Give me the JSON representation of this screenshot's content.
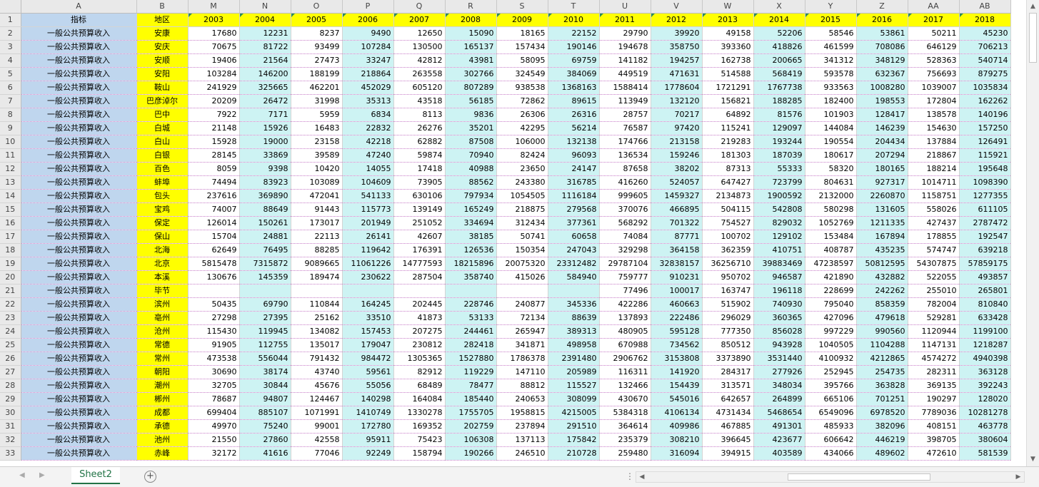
{
  "columns": [
    "A",
    "B",
    "M",
    "N",
    "O",
    "P",
    "Q",
    "R",
    "S",
    "T",
    "U",
    "V",
    "W",
    "X",
    "Y",
    "Z",
    "AA",
    "AB"
  ],
  "header": {
    "indicator": "指标",
    "region": "地区",
    "years": [
      "2003",
      "2004",
      "2005",
      "2006",
      "2007",
      "2008",
      "2009",
      "2010",
      "2011",
      "2012",
      "2013",
      "2014",
      "2015",
      "2016",
      "2017",
      "2018"
    ]
  },
  "rows": [
    {
      "num": "2",
      "indicator": "一般公共预算收入",
      "region": "安康",
      "values": [
        "17680",
        "12231",
        "8237",
        "9490",
        "12650",
        "15090",
        "18165",
        "22152",
        "29790",
        "39920",
        "49158",
        "52206",
        "58546",
        "53861",
        "50211",
        "45230"
      ]
    },
    {
      "num": "3",
      "indicator": "一般公共预算收入",
      "region": "安庆",
      "values": [
        "70675",
        "81722",
        "93499",
        "107284",
        "130500",
        "165137",
        "157434",
        "190146",
        "194678",
        "358750",
        "393360",
        "418826",
        "461599",
        "708086",
        "646129",
        "706213"
      ]
    },
    {
      "num": "4",
      "indicator": "一般公共预算收入",
      "region": "安顺",
      "values": [
        "19406",
        "21564",
        "27473",
        "33247",
        "42812",
        "43981",
        "58095",
        "69759",
        "141182",
        "194257",
        "162738",
        "200665",
        "341312",
        "348129",
        "528363",
        "540714"
      ]
    },
    {
      "num": "5",
      "indicator": "一般公共预算收入",
      "region": "安阳",
      "values": [
        "103284",
        "146200",
        "188199",
        "218864",
        "263558",
        "302766",
        "324549",
        "384069",
        "449519",
        "471631",
        "514588",
        "568419",
        "593578",
        "632367",
        "756693",
        "879275"
      ]
    },
    {
      "num": "6",
      "indicator": "一般公共预算收入",
      "region": "鞍山",
      "values": [
        "241929",
        "325665",
        "462201",
        "452029",
        "605120",
        "807289",
        "938538",
        "1368163",
        "1588414",
        "1778604",
        "1721291",
        "1767738",
        "933563",
        "1008280",
        "1039007",
        "1035834"
      ]
    },
    {
      "num": "7",
      "indicator": "一般公共预算收入",
      "region": "巴彦淖尔",
      "values": [
        "20209",
        "26472",
        "31998",
        "35313",
        "43518",
        "56185",
        "72862",
        "89615",
        "113949",
        "132120",
        "156821",
        "188285",
        "182400",
        "198553",
        "172804",
        "162262"
      ]
    },
    {
      "num": "8",
      "indicator": "一般公共预算收入",
      "region": "巴中",
      "values": [
        "7922",
        "7171",
        "5959",
        "6834",
        "8113",
        "9836",
        "26306",
        "26316",
        "28757",
        "70217",
        "64892",
        "81576",
        "101903",
        "128417",
        "138578",
        "140196"
      ]
    },
    {
      "num": "9",
      "indicator": "一般公共预算收入",
      "region": "白城",
      "values": [
        "21148",
        "15926",
        "16483",
        "22832",
        "26276",
        "35201",
        "42295",
        "56214",
        "76587",
        "97420",
        "115241",
        "129097",
        "144084",
        "146239",
        "154630",
        "157250"
      ]
    },
    {
      "num": "10",
      "indicator": "一般公共预算收入",
      "region": "白山",
      "values": [
        "15928",
        "19000",
        "23158",
        "42218",
        "62882",
        "87508",
        "106000",
        "132138",
        "174766",
        "213158",
        "219283",
        "193244",
        "190554",
        "204434",
        "137884",
        "126491"
      ]
    },
    {
      "num": "11",
      "indicator": "一般公共预算收入",
      "region": "白银",
      "values": [
        "28145",
        "33869",
        "39589",
        "47240",
        "59874",
        "70940",
        "82424",
        "96093",
        "136534",
        "159246",
        "181303",
        "187039",
        "180617",
        "207294",
        "218867",
        "115921"
      ]
    },
    {
      "num": "12",
      "indicator": "一般公共预算收入",
      "region": "百色",
      "values": [
        "8059",
        "9398",
        "10420",
        "14055",
        "17418",
        "40988",
        "23650",
        "24147",
        "87658",
        "38202",
        "87313",
        "55333",
        "58320",
        "180165",
        "188214",
        "195648"
      ]
    },
    {
      "num": "13",
      "indicator": "一般公共预算收入",
      "region": "蚌埠",
      "values": [
        "74494",
        "83923",
        "103089",
        "104609",
        "73905",
        "88562",
        "243380",
        "316785",
        "416260",
        "524057",
        "647427",
        "723799",
        "804631",
        "927317",
        "1014711",
        "1098390"
      ]
    },
    {
      "num": "14",
      "indicator": "一般公共预算收入",
      "region": "包头",
      "values": [
        "237616",
        "369890",
        "472041",
        "541133",
        "630106",
        "797934",
        "1054505",
        "1116184",
        "999605",
        "1459327",
        "2134873",
        "1900592",
        "2132000",
        "2260870",
        "1158751",
        "1277355"
      ]
    },
    {
      "num": "15",
      "indicator": "一般公共预算收入",
      "region": "宝鸡",
      "values": [
        "74007",
        "88649",
        "91443",
        "115773",
        "139149",
        "165249",
        "218875",
        "279568",
        "370076",
        "466895",
        "504115",
        "542808",
        "580298",
        "131605",
        "558026",
        "611105"
      ]
    },
    {
      "num": "16",
      "indicator": "一般公共预算收入",
      "region": "保定",
      "values": [
        "126014",
        "150261",
        "173017",
        "201949",
        "251052",
        "334694",
        "312434",
        "377361",
        "568292",
        "701322",
        "754527",
        "829032",
        "1052769",
        "1211335",
        "427437",
        "2787472"
      ]
    },
    {
      "num": "17",
      "indicator": "一般公共预算收入",
      "region": "保山",
      "values": [
        "15704",
        "24881",
        "22113",
        "26141",
        "42607",
        "38185",
        "50741",
        "60658",
        "74084",
        "87771",
        "100702",
        "129102",
        "153484",
        "167894",
        "178855",
        "192547"
      ]
    },
    {
      "num": "18",
      "indicator": "一般公共预算收入",
      "region": "北海",
      "values": [
        "62649",
        "76495",
        "88285",
        "119642",
        "176391",
        "126536",
        "150354",
        "247043",
        "329298",
        "364158",
        "362359",
        "410751",
        "408787",
        "435235",
        "574747",
        "639218"
      ]
    },
    {
      "num": "19",
      "indicator": "一般公共预算收入",
      "region": "北京",
      "values": [
        "5815478",
        "7315872",
        "9089665",
        "11061226",
        "14777593",
        "18215896",
        "20075320",
        "23312482",
        "29787104",
        "32838157",
        "36256710",
        "39883469",
        "47238597",
        "50812595",
        "54307875",
        "57859175"
      ]
    },
    {
      "num": "20",
      "indicator": "一般公共预算收入",
      "region": "本溪",
      "values": [
        "130676",
        "145359",
        "189474",
        "230622",
        "287504",
        "358740",
        "415026",
        "584940",
        "759777",
        "910231",
        "950702",
        "946587",
        "421890",
        "432882",
        "522055",
        "493857"
      ]
    },
    {
      "num": "21",
      "indicator": "一般公共预算收入",
      "region": "毕节",
      "values": [
        "",
        "",
        "",
        "",
        "",
        "",
        "",
        "",
        "77496",
        "100017",
        "163747",
        "196118",
        "228699",
        "242262",
        "255010",
        "265801"
      ]
    },
    {
      "num": "22",
      "indicator": "一般公共预算收入",
      "region": "滨州",
      "values": [
        "50435",
        "69790",
        "110844",
        "164245",
        "202445",
        "228746",
        "240877",
        "345336",
        "422286",
        "460663",
        "515902",
        "740930",
        "795040",
        "858359",
        "782004",
        "810840"
      ]
    },
    {
      "num": "23",
      "indicator": "一般公共预算收入",
      "region": "亳州",
      "values": [
        "27298",
        "27395",
        "25162",
        "33510",
        "41873",
        "53133",
        "72134",
        "88639",
        "137893",
        "222486",
        "296029",
        "360365",
        "427096",
        "479618",
        "529281",
        "633428"
      ]
    },
    {
      "num": "24",
      "indicator": "一般公共预算收入",
      "region": "沧州",
      "values": [
        "115430",
        "119945",
        "134082",
        "157453",
        "207275",
        "244461",
        "265947",
        "389313",
        "480905",
        "595128",
        "777350",
        "856028",
        "997229",
        "990560",
        "1120944",
        "1199100"
      ]
    },
    {
      "num": "25",
      "indicator": "一般公共预算收入",
      "region": "常德",
      "values": [
        "91905",
        "112755",
        "135017",
        "179047",
        "230812",
        "282418",
        "341871",
        "498958",
        "670988",
        "734562",
        "850512",
        "943928",
        "1040505",
        "1104288",
        "1147131",
        "1218287"
      ]
    },
    {
      "num": "26",
      "indicator": "一般公共预算收入",
      "region": "常州",
      "values": [
        "473538",
        "556044",
        "791432",
        "984472",
        "1305365",
        "1527880",
        "1786378",
        "2391480",
        "2906762",
        "3153808",
        "3373890",
        "3531440",
        "4100932",
        "4212865",
        "4574272",
        "4940398"
      ]
    },
    {
      "num": "27",
      "indicator": "一般公共预算收入",
      "region": "朝阳",
      "values": [
        "30690",
        "38174",
        "43740",
        "59561",
        "82912",
        "119229",
        "147110",
        "205989",
        "116311",
        "141920",
        "284317",
        "277926",
        "252945",
        "254735",
        "282311",
        "363128"
      ]
    },
    {
      "num": "28",
      "indicator": "一般公共预算收入",
      "region": "潮州",
      "values": [
        "32705",
        "30844",
        "45676",
        "55056",
        "68489",
        "78477",
        "88812",
        "115527",
        "132466",
        "154439",
        "313571",
        "348034",
        "395766",
        "363828",
        "369135",
        "392243"
      ]
    },
    {
      "num": "29",
      "indicator": "一般公共预算收入",
      "region": "郴州",
      "values": [
        "78687",
        "94807",
        "124467",
        "140298",
        "164084",
        "185440",
        "240653",
        "308099",
        "430670",
        "545016",
        "642657",
        "264899",
        "665106",
        "701251",
        "190297",
        "128020"
      ]
    },
    {
      "num": "30",
      "indicator": "一般公共预算收入",
      "region": "成都",
      "values": [
        "699404",
        "885107",
        "1071991",
        "1410749",
        "1330278",
        "1755705",
        "1958815",
        "4215005",
        "5384318",
        "4106134",
        "4731434",
        "5468654",
        "6549096",
        "6978520",
        "7789036",
        "10281278"
      ]
    },
    {
      "num": "31",
      "indicator": "一般公共预算收入",
      "region": "承德",
      "values": [
        "49970",
        "75240",
        "99001",
        "172780",
        "169352",
        "202759",
        "237894",
        "291510",
        "364614",
        "409986",
        "467885",
        "491301",
        "485933",
        "382096",
        "408151",
        "463778"
      ]
    },
    {
      "num": "32",
      "indicator": "一般公共预算收入",
      "region": "池州",
      "values": [
        "21550",
        "27860",
        "42558",
        "95911",
        "75423",
        "106308",
        "137113",
        "175842",
        "235379",
        "308210",
        "396645",
        "423677",
        "606642",
        "446219",
        "398705",
        "380604"
      ]
    },
    {
      "num": "33",
      "indicator": "一般公共预算收入",
      "region": "赤峰",
      "values": [
        "32172",
        "41616",
        "77046",
        "92249",
        "158794",
        "190266",
        "246510",
        "210728",
        "259480",
        "316094",
        "394915",
        "403589",
        "434066",
        "489602",
        "472610",
        "581539"
      ]
    }
  ],
  "sheet_tabs": [
    "Sheet2"
  ],
  "icons": {
    "prev": "◀",
    "next": "▶",
    "up": "▲",
    "down": "▼",
    "add": "+",
    "splitter": "⋮"
  }
}
